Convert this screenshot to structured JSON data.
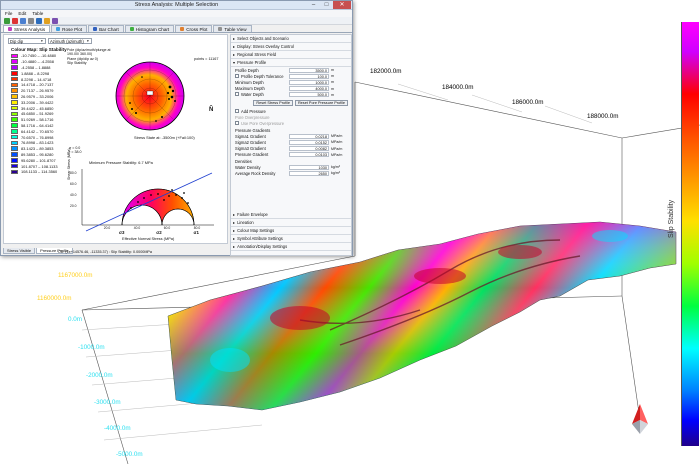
{
  "window": {
    "title": "Stress Analysis: Multiple Selection",
    "controls": [
      "–",
      "□",
      "✕"
    ]
  },
  "menu": [
    "File",
    "Edit",
    "Table"
  ],
  "tabs": [
    {
      "label": "Stress Analysis",
      "active": true
    },
    {
      "label": "Rose Plot",
      "active": false
    },
    {
      "label": "Bar Chart",
      "active": false
    },
    {
      "label": "Histogram Chart",
      "active": false
    },
    {
      "label": "Cross Plot",
      "active": false
    },
    {
      "label": "Table View",
      "active": false
    }
  ],
  "left_pane": {
    "dropdown_1": "Dip dip",
    "dropdown_2": "Azimuth (azimuth)",
    "legend_title": "Colour Map: Slip Stability",
    "legend": [
      {
        "label": "-10.7450 – -10.4880",
        "color": "#ff00ff"
      },
      {
        "label": "-10.4880 – -4.2558",
        "color": "#e000ff"
      },
      {
        "label": "-4.2558 – 1.8888",
        "color": "#b000ff"
      },
      {
        "label": "1.8888 – 8.2298",
        "color": "#ff0000"
      },
      {
        "label": "8.2298 – 14.4718",
        "color": "#ff3000"
      },
      {
        "label": "14.4718 – 20.7137",
        "color": "#ff6000"
      },
      {
        "label": "20.7137 – 26.9579",
        "color": "#ff9000"
      },
      {
        "label": "26.9579 – 33.2006",
        "color": "#ffc000"
      },
      {
        "label": "33.2006 – 39.4422",
        "color": "#ffef00"
      },
      {
        "label": "39.4422 – 45.6850",
        "color": "#d8ff00"
      },
      {
        "label": "45.6850 – 51.9269",
        "color": "#90ff00"
      },
      {
        "label": "51.9269 – 58.1716",
        "color": "#40ff00"
      },
      {
        "label": "58.1716 – 64.4142",
        "color": "#00ff40"
      },
      {
        "label": "64.4142 – 70.6570",
        "color": "#00ff90"
      },
      {
        "label": "70.6570 – 76.8998",
        "color": "#00ffe0"
      },
      {
        "label": "76.8998 – 83.1423",
        "color": "#00d0ff"
      },
      {
        "label": "83.1423 – 89.3853",
        "color": "#0090ff"
      },
      {
        "label": "89.3853 – 95.6280",
        "color": "#0050ff"
      },
      {
        "label": "95.6280 – 101.8707",
        "color": "#0010ff"
      },
      {
        "label": "101.8707 – 108.1133",
        "color": "#1a00d8"
      },
      {
        "label": "108.1133 – 114.3560",
        "color": "#2a0090"
      }
    ],
    "stereonet_caption": "Pole (dip/azimuth/plunge at 190.00/ 360.00)\nPlane (dip/dip az 0)\nSlip Stability",
    "points_label": "points = 11167",
    "mohr_legend": [
      "σ = 0.0",
      "τ = 38.0"
    ],
    "mohr_header": "Stress State at: -3500m (+Fail:100)",
    "mohr_sub": "Minimum Pressure Stability: 6.7 MPa",
    "mohr_ylabel": "Shear Stress (MPa)",
    "mohr_xlabel": "Effective Normal Stress (MPa)",
    "mohr_yticks": [
      "80.0",
      "60.0",
      "40.0",
      "20.0"
    ],
    "mohr_xticks": [
      "20.0",
      "40.0",
      "60.0",
      "80.0"
    ],
    "sigma_labels": [
      "σ3",
      "σ2",
      "σ1"
    ],
    "status": "CD: (1e+14576.46, -11335.37) : Slip Stability: 0.0000MPa"
  },
  "bottom_tabs": [
    "Stress Visible",
    "Pressure Profile"
  ],
  "right_pane": {
    "sections_top": [
      "Select Objects and Scenario",
      "Display: Stress Overlay Control",
      "Regional Stress Field",
      "Pressure Profile"
    ],
    "fields": [
      {
        "label": "Profile Depth",
        "value": "3500.0",
        "unit": "m"
      },
      {
        "label": "Profile Depth Tolerance",
        "value": "100.0",
        "unit": "m"
      },
      {
        "label": "Minimum Depth",
        "value": "1000.0",
        "unit": "m"
      },
      {
        "label": "Maximum Depth",
        "value": "4000.0",
        "unit": "m"
      },
      {
        "label": "Water Depth",
        "value": "500.0",
        "unit": "m"
      }
    ],
    "buttons": [
      "Reset Stress Profile",
      "Reset Pore Pressure Profile"
    ],
    "add_pressure": "Add Pressure",
    "gray_labels": [
      "Pore Overpressure",
      "Use Pore Overpressure"
    ],
    "pressure_gradients_header": "Pressure Gradients",
    "gradients": [
      {
        "label": "Sigma1 Gradient",
        "value": "0.0218",
        "unit": "MPa/m"
      },
      {
        "label": "Sigma2 Gradient",
        "value": "0.0152",
        "unit": "MPa/m"
      },
      {
        "label": "Sigma3 Gradient",
        "value": "0.0082",
        "unit": "MPa/m"
      },
      {
        "label": "Pressure Gradient",
        "value": "0.0103",
        "unit": "MPa/m"
      }
    ],
    "densities_header": "Densities",
    "densities": [
      {
        "label": "Water Density",
        "value": "1030",
        "unit": "kg/m³"
      },
      {
        "label": "Average Rock Density",
        "value": "2650",
        "unit": "kg/m³"
      }
    ],
    "sections_bottom": [
      "Failure Envelope",
      "Lineation",
      "Colour Map Settings",
      "Symbol Attribute Settings",
      "Annotation/Display Settings"
    ]
  },
  "viewport": {
    "x_labels": [
      "182000.0m",
      "184000.0m",
      "186000.0m",
      "188000.0m"
    ],
    "y_labels": [
      "1167000.0m",
      "1160000.0m"
    ],
    "z_labels": [
      "0.0m",
      "-1000.0m",
      "-2000.0m",
      "-3000.0m",
      "-4000.0m",
      "-5000.0m"
    ],
    "colorbar_label": "Slip Stability"
  }
}
